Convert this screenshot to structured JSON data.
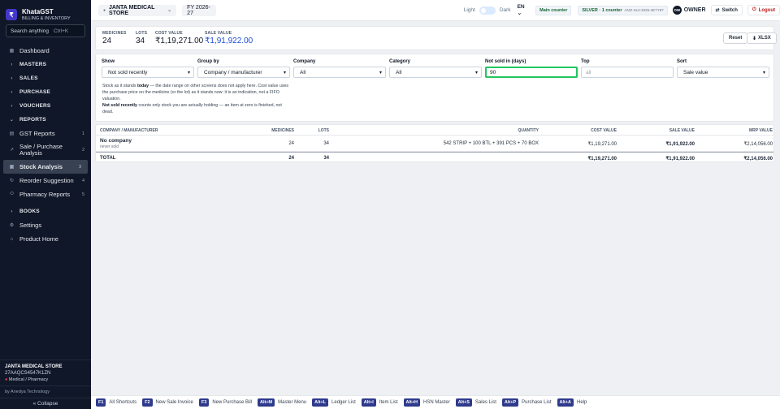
{
  "brand": {
    "logo": "₹",
    "name": "KhataGST",
    "tagline": "BILLING & INVENTORY"
  },
  "search": {
    "placeholder": "Search anything",
    "shortcut": "Ctrl+K"
  },
  "nav": [
    {
      "label": "Dashboard",
      "icon": "grid-icon"
    },
    {
      "label": "MASTERS",
      "icon": "chevron-right-icon",
      "section": true
    },
    {
      "label": "SALES",
      "icon": "chevron-right-icon",
      "section": true
    },
    {
      "label": "PURCHASE",
      "icon": "chevron-right-icon",
      "section": true
    },
    {
      "label": "VOUCHERS",
      "icon": "chevron-right-icon",
      "section": true
    },
    {
      "label": "REPORTS",
      "icon": "chevron-down-icon",
      "section": true
    },
    {
      "label": "GST Reports",
      "num": "1",
      "icon": "document-icon"
    },
    {
      "label": "Sale / Purchase Analysis",
      "num": "2",
      "icon": "trend-icon"
    },
    {
      "label": "Stock Analysis",
      "num": "3",
      "icon": "box-icon",
      "active": true
    },
    {
      "label": "Reorder Suggestion",
      "num": "4",
      "icon": "refresh-icon"
    },
    {
      "label": "Pharmacy Reports",
      "num": "5",
      "icon": "pill-icon"
    },
    {
      "label": "BOOKS",
      "icon": "chevron-right-icon",
      "section": true
    },
    {
      "label": "Settings",
      "icon": "gear-icon"
    },
    {
      "label": "Product Home",
      "icon": "home-icon"
    }
  ],
  "sidebar_footer": {
    "store_name": "JANTA MEDICAL STORE",
    "gstin": "27AAQCS4547K1ZN",
    "store_type": "Medical / Pharmacy",
    "by": "by Anedya Technology",
    "collapse": "« Collapse"
  },
  "topbar": {
    "store": "JANTA MEDICAL STORE",
    "fy": "FY 2026-27",
    "light": "Light",
    "dark": "Dark",
    "lang": "EN",
    "counter": "Main counter",
    "plan": "SILVER · 1 counter",
    "plan_code": "ANO-SLV-2026-4E7Y97",
    "avatar": "OW",
    "owner": "OWNER",
    "switch": "Switch",
    "logout": "Logout"
  },
  "summary": {
    "medicines_label": "MEDICINES",
    "medicines": "24",
    "lots_label": "LOTS",
    "lots": "34",
    "cost_label": "COST VALUE",
    "cost": "₹1,19,271.00",
    "sale_label": "SALE VALUE",
    "sale": "₹1,91,922.00",
    "reset": "Reset",
    "xlsx": "XLSX"
  },
  "filters": {
    "show_label": "Show",
    "show": "Not sold recently",
    "group_label": "Group by",
    "group": "Company / manufacturer",
    "company_label": "Company",
    "company": "All",
    "category_label": "Category",
    "category": "All",
    "notsold_label": "Not sold in (days)",
    "notsold": "90",
    "top_label": "Top",
    "top_placeholder": "all",
    "sort_label": "Sort",
    "sort": "Sale value",
    "hint_1": "Stock as it stands ",
    "hint_today": "today",
    "hint_2": " — the date range on other screens does not apply here. Cost value uses the purchase price on the medicine (or the lot) as it stands now: it is an indication, not a FIFO valuation.",
    "hint_nsr": "Not sold recently",
    "hint_3": " counts only stock you are actually holding — an item at zero is finished, not dead."
  },
  "table": {
    "headers": [
      "COMPANY / MANUFACTURER",
      "MEDICINES",
      "LOTS",
      "QUANTITY",
      "COST VALUE",
      "SALE VALUE",
      "MRP VALUE"
    ],
    "row": {
      "company": "No company",
      "sub": "never sold",
      "medicines": "24",
      "lots": "34",
      "quantity": "542 STRIP + 100 BTL + 391 PCS + 70 BOX",
      "cost": "₹1,19,271.00",
      "sale": "₹1,91,922.00",
      "mrp": "₹2,14,056.00"
    },
    "total": {
      "label": "TOTAL",
      "medicines": "24",
      "lots": "34",
      "cost": "₹1,19,271.00",
      "sale": "₹1,91,922.00",
      "mrp": "₹2,14,056.00"
    }
  },
  "shortcuts": [
    {
      "key": "F1",
      "label": "All Shortcuts"
    },
    {
      "key": "F2",
      "label": "New Sale Invoice"
    },
    {
      "key": "F3",
      "label": "New Purchase Bill"
    },
    {
      "key": "Alt+M",
      "label": "Master Menu"
    },
    {
      "key": "Alt+L",
      "label": "Ledger List"
    },
    {
      "key": "Alt+I",
      "label": "Item List"
    },
    {
      "key": "Alt+H",
      "label": "HSN Master"
    },
    {
      "key": "Alt+S",
      "label": "Sales List"
    },
    {
      "key": "Alt+P",
      "label": "Purchase List"
    },
    {
      "key": "Alt+A",
      "label": "Help"
    }
  ]
}
